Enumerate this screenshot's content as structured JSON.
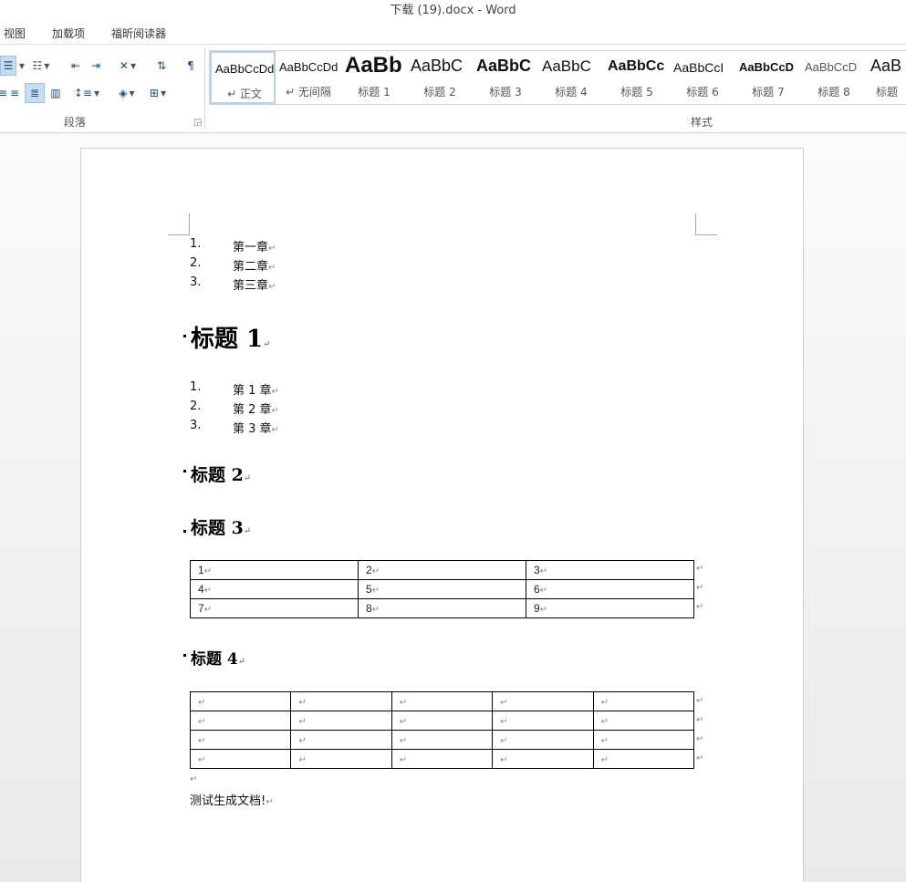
{
  "window": {
    "title": "下载 (19).docx - Word"
  },
  "menu": {
    "tabs": [
      "视图",
      "加载项",
      "福昕阅读器"
    ]
  },
  "ribbon": {
    "paragraph_group_label": "段落",
    "styles_group_label": "样式",
    "styles": [
      {
        "sample": "AaBbCcDd",
        "name": "↵ 正文"
      },
      {
        "sample": "AaBbCcDd",
        "name": "↵ 无间隔"
      },
      {
        "sample": "AaBb",
        "name": "标题 1"
      },
      {
        "sample": "AaBbC",
        "name": "标题 2"
      },
      {
        "sample": "AaBbC",
        "name": "标题 3"
      },
      {
        "sample": "AaBbC",
        "name": "标题 4"
      },
      {
        "sample": "AaBbCc",
        "name": "标题 5"
      },
      {
        "sample": "AaBbCcI",
        "name": "标题 6"
      },
      {
        "sample": "AaBbCcD",
        "name": "标题 7"
      },
      {
        "sample": "AaBbCcD",
        "name": "标题 8"
      },
      {
        "sample": "AaB",
        "name": "标题"
      }
    ]
  },
  "document": {
    "list1": [
      {
        "num": "1.",
        "text": "第一章"
      },
      {
        "num": "2.",
        "text": "第二章"
      },
      {
        "num": "3.",
        "text": "第三章"
      }
    ],
    "heading1": "标题 1",
    "list2": [
      {
        "num": "1.",
        "text": "第 1 章"
      },
      {
        "num": "2.",
        "text": "第 2 章"
      },
      {
        "num": "3.",
        "text": "第 3 章"
      }
    ],
    "heading2": "标题 2",
    "heading3": "标题 3",
    "table1": [
      [
        "1",
        "2",
        "3"
      ],
      [
        "4",
        "5",
        "6"
      ],
      [
        "7",
        "8",
        "9"
      ]
    ],
    "heading4": "标题 4",
    "table2": {
      "rows": 4,
      "cols": 5
    },
    "body_text": "测试生成文档!",
    "paragraph_mark": "↵"
  }
}
